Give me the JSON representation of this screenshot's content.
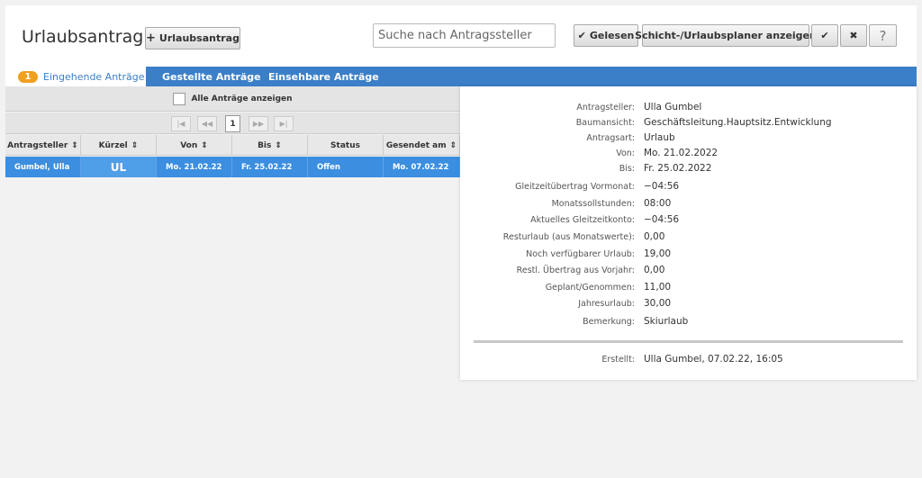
{
  "header": {
    "title": "Urlaubsantrag",
    "new_button": "Urlaubsantrag",
    "search_placeholder": "Suche nach Antragssteller",
    "read_button": "Gelesen",
    "planner_button": "Schicht-/Urlaubsplaner anzeigen",
    "help_label": "?"
  },
  "tabs": {
    "incoming": "Eingehende Anträge",
    "incoming_count": "1",
    "sent": "Gestellte Anträge",
    "viewable": "Einsehbare Anträge"
  },
  "list": {
    "show_all": "Alle Anträge anzeigen",
    "current_page": "1",
    "columns": [
      "Antragsteller",
      "Kürzel",
      "Von",
      "Bis",
      "Status",
      "Gesendet am"
    ],
    "rows": [
      [
        "Gumbel, Ulla",
        "UL",
        "Mo. 21.02.22",
        "Fr. 25.02.22",
        "Offen",
        "Mo. 07.02.22"
      ]
    ]
  },
  "detail": {
    "applicant_label": "Antragsteller:",
    "applicant": "Ulla Gumbel",
    "tree_label": "Baumansicht:",
    "tree": "Geschäftsleitung.Hauptsitz.Entwicklung",
    "type_label": "Antragsart:",
    "type": "Urlaub",
    "from_label": "Von:",
    "from": "Mo. 21.02.2022",
    "to_label": "Bis:",
    "to": "Fr. 25.02.2022",
    "carry_label": "Gleitzeitübertrag Vormonat:",
    "carry": "−04:56",
    "monthly_label": "Monatssollstunden:",
    "monthly": "08:00",
    "account_label": "Aktuelles Gleitzeitkonto:",
    "account": "−04:56",
    "rest_label": "Resturlaub (aus Monatswerte):",
    "rest": "0,00",
    "available_label": "Noch verfügbarer Urlaub:",
    "available": "19,00",
    "prev_label": "Restl. Übertrag aus Vorjahr:",
    "prev": "0,00",
    "planned_label": "Geplant/Genommen:",
    "planned": "11,00",
    "annual_label": "Jahresurlaub:",
    "annual": "30,00",
    "remark_label": "Bemerkung:",
    "remark": "Skiurlaub",
    "created_label": "Erstellt:",
    "created": "Ulla Gumbel, 07.02.22, 16:05"
  }
}
